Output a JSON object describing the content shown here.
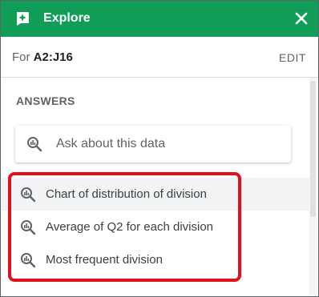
{
  "header": {
    "title": "Explore",
    "color": "#0f9d58",
    "logo_icon": "explore-logo-icon",
    "close_icon": "close-icon"
  },
  "range": {
    "prefix": "For",
    "value": "A2:J16",
    "edit_label": "EDIT"
  },
  "answers": {
    "heading": "ANSWERS",
    "search_placeholder": "Ask about this data",
    "search_icon": "search-chart-icon",
    "suggestions": [
      "Chart of distribution of division",
      "Average of Q2 for each division",
      "Most frequent division"
    ]
  },
  "annotation": {
    "color": "#e3101c"
  }
}
